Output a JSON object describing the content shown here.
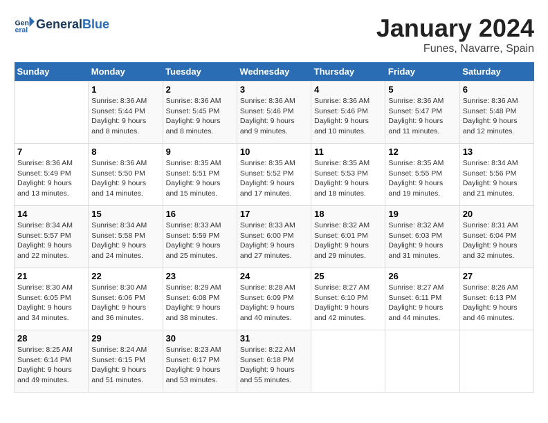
{
  "logo": {
    "general": "General",
    "blue": "Blue"
  },
  "title": "January 2024",
  "location": "Funes, Navarre, Spain",
  "days_of_week": [
    "Sunday",
    "Monday",
    "Tuesday",
    "Wednesday",
    "Thursday",
    "Friday",
    "Saturday"
  ],
  "weeks": [
    [
      {
        "day": "",
        "info": ""
      },
      {
        "day": "1",
        "info": "Sunrise: 8:36 AM\nSunset: 5:44 PM\nDaylight: 9 hours\nand 8 minutes."
      },
      {
        "day": "2",
        "info": "Sunrise: 8:36 AM\nSunset: 5:45 PM\nDaylight: 9 hours\nand 8 minutes."
      },
      {
        "day": "3",
        "info": "Sunrise: 8:36 AM\nSunset: 5:46 PM\nDaylight: 9 hours\nand 9 minutes."
      },
      {
        "day": "4",
        "info": "Sunrise: 8:36 AM\nSunset: 5:46 PM\nDaylight: 9 hours\nand 10 minutes."
      },
      {
        "day": "5",
        "info": "Sunrise: 8:36 AM\nSunset: 5:47 PM\nDaylight: 9 hours\nand 11 minutes."
      },
      {
        "day": "6",
        "info": "Sunrise: 8:36 AM\nSunset: 5:48 PM\nDaylight: 9 hours\nand 12 minutes."
      }
    ],
    [
      {
        "day": "7",
        "info": "Sunrise: 8:36 AM\nSunset: 5:49 PM\nDaylight: 9 hours\nand 13 minutes."
      },
      {
        "day": "8",
        "info": "Sunrise: 8:36 AM\nSunset: 5:50 PM\nDaylight: 9 hours\nand 14 minutes."
      },
      {
        "day": "9",
        "info": "Sunrise: 8:35 AM\nSunset: 5:51 PM\nDaylight: 9 hours\nand 15 minutes."
      },
      {
        "day": "10",
        "info": "Sunrise: 8:35 AM\nSunset: 5:52 PM\nDaylight: 9 hours\nand 17 minutes."
      },
      {
        "day": "11",
        "info": "Sunrise: 8:35 AM\nSunset: 5:53 PM\nDaylight: 9 hours\nand 18 minutes."
      },
      {
        "day": "12",
        "info": "Sunrise: 8:35 AM\nSunset: 5:55 PM\nDaylight: 9 hours\nand 19 minutes."
      },
      {
        "day": "13",
        "info": "Sunrise: 8:34 AM\nSunset: 5:56 PM\nDaylight: 9 hours\nand 21 minutes."
      }
    ],
    [
      {
        "day": "14",
        "info": "Sunrise: 8:34 AM\nSunset: 5:57 PM\nDaylight: 9 hours\nand 22 minutes."
      },
      {
        "day": "15",
        "info": "Sunrise: 8:34 AM\nSunset: 5:58 PM\nDaylight: 9 hours\nand 24 minutes."
      },
      {
        "day": "16",
        "info": "Sunrise: 8:33 AM\nSunset: 5:59 PM\nDaylight: 9 hours\nand 25 minutes."
      },
      {
        "day": "17",
        "info": "Sunrise: 8:33 AM\nSunset: 6:00 PM\nDaylight: 9 hours\nand 27 minutes."
      },
      {
        "day": "18",
        "info": "Sunrise: 8:32 AM\nSunset: 6:01 PM\nDaylight: 9 hours\nand 29 minutes."
      },
      {
        "day": "19",
        "info": "Sunrise: 8:32 AM\nSunset: 6:03 PM\nDaylight: 9 hours\nand 31 minutes."
      },
      {
        "day": "20",
        "info": "Sunrise: 8:31 AM\nSunset: 6:04 PM\nDaylight: 9 hours\nand 32 minutes."
      }
    ],
    [
      {
        "day": "21",
        "info": "Sunrise: 8:30 AM\nSunset: 6:05 PM\nDaylight: 9 hours\nand 34 minutes."
      },
      {
        "day": "22",
        "info": "Sunrise: 8:30 AM\nSunset: 6:06 PM\nDaylight: 9 hours\nand 36 minutes."
      },
      {
        "day": "23",
        "info": "Sunrise: 8:29 AM\nSunset: 6:08 PM\nDaylight: 9 hours\nand 38 minutes."
      },
      {
        "day": "24",
        "info": "Sunrise: 8:28 AM\nSunset: 6:09 PM\nDaylight: 9 hours\nand 40 minutes."
      },
      {
        "day": "25",
        "info": "Sunrise: 8:27 AM\nSunset: 6:10 PM\nDaylight: 9 hours\nand 42 minutes."
      },
      {
        "day": "26",
        "info": "Sunrise: 8:27 AM\nSunset: 6:11 PM\nDaylight: 9 hours\nand 44 minutes."
      },
      {
        "day": "27",
        "info": "Sunrise: 8:26 AM\nSunset: 6:13 PM\nDaylight: 9 hours\nand 46 minutes."
      }
    ],
    [
      {
        "day": "28",
        "info": "Sunrise: 8:25 AM\nSunset: 6:14 PM\nDaylight: 9 hours\nand 49 minutes."
      },
      {
        "day": "29",
        "info": "Sunrise: 8:24 AM\nSunset: 6:15 PM\nDaylight: 9 hours\nand 51 minutes."
      },
      {
        "day": "30",
        "info": "Sunrise: 8:23 AM\nSunset: 6:17 PM\nDaylight: 9 hours\nand 53 minutes."
      },
      {
        "day": "31",
        "info": "Sunrise: 8:22 AM\nSunset: 6:18 PM\nDaylight: 9 hours\nand 55 minutes."
      },
      {
        "day": "",
        "info": ""
      },
      {
        "day": "",
        "info": ""
      },
      {
        "day": "",
        "info": ""
      }
    ]
  ]
}
